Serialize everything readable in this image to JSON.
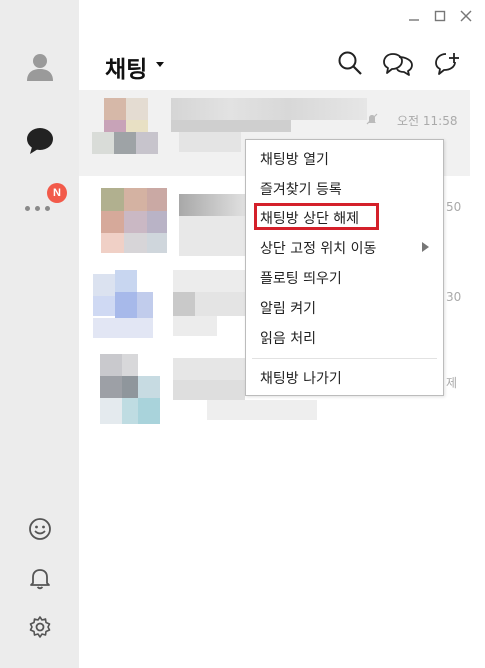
{
  "window": {
    "minimize_icon": "minimize-icon",
    "maximize_icon": "maximize-icon",
    "close_icon": "close-icon"
  },
  "header": {
    "title": "채팅",
    "dropdown_icon": "caret-down-icon",
    "search_icon": "search-icon",
    "open_chat_icon": "open-chat-icon",
    "new_chat_icon": "new-chat-icon"
  },
  "sidebar": {
    "items": [
      {
        "name": "friends",
        "icon": "person-icon"
      },
      {
        "name": "chats",
        "icon": "chat-bubble-icon"
      },
      {
        "name": "more",
        "icon": "more-dots-icon",
        "badge": "N"
      }
    ],
    "bottom": [
      {
        "name": "emoticon",
        "icon": "smiley-icon"
      },
      {
        "name": "notifications",
        "icon": "bell-icon"
      },
      {
        "name": "settings",
        "icon": "gear-icon"
      }
    ]
  },
  "chats": [
    {
      "time": "오전 11:58",
      "muted": true
    },
    {
      "time": "50"
    },
    {
      "time": "30"
    },
    {
      "time": "제"
    }
  ],
  "context_menu": {
    "items": [
      {
        "label": "채팅방 열기"
      },
      {
        "label": "즐겨찾기 등록"
      },
      {
        "label": "채팅방 상단 해제",
        "highlighted": true
      },
      {
        "label": "상단 고정 위치 이동",
        "submenu": true
      },
      {
        "label": "플로팅 띄우기"
      },
      {
        "label": "알림 켜기"
      },
      {
        "label": "읽음 처리"
      },
      {
        "label": "채팅방 나가기"
      }
    ]
  },
  "colors": {
    "highlight": "#d4202a",
    "badge": "#f25a4a",
    "sidebar": "#ececec",
    "selected_row": "#f1f1f1"
  }
}
